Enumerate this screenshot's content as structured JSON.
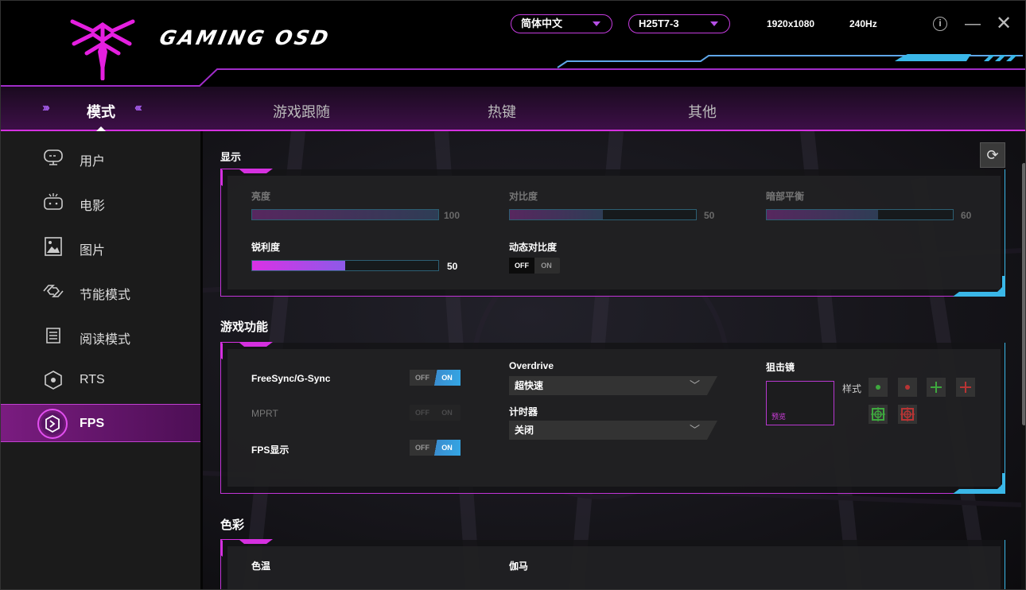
{
  "header": {
    "brand": "GAMING OSD",
    "language": "简体中文",
    "model": "H25T7-3",
    "resolution": "1920x1080",
    "refresh_rate": "240Hz",
    "info_icon": "i"
  },
  "tabs": [
    {
      "label": "模式"
    },
    {
      "label": "游戏跟随"
    },
    {
      "label": "热键"
    },
    {
      "label": "其他"
    }
  ],
  "sidebar": {
    "items": [
      {
        "label": "用户",
        "icon": "monitor-icon"
      },
      {
        "label": "电影",
        "icon": "cinema-icon"
      },
      {
        "label": "图片",
        "icon": "picture-icon"
      },
      {
        "label": "节能模式",
        "icon": "eco-icon"
      },
      {
        "label": "阅读模式",
        "icon": "reading-icon"
      },
      {
        "label": "RTS",
        "icon": "rts-icon"
      },
      {
        "label": "FPS",
        "icon": "fps-icon",
        "active": true
      }
    ]
  },
  "display": {
    "title": "显示",
    "brightness": {
      "label": "亮度",
      "value": "100",
      "fraction": 1.0
    },
    "contrast": {
      "label": "对比度",
      "value": "50",
      "fraction": 0.5
    },
    "dark_balance": {
      "label": "暗部平衡",
      "value": "60",
      "fraction": 0.6
    },
    "sharpness": {
      "label": "锐利度",
      "value": "50",
      "fraction": 0.5
    },
    "dynamic_contrast": {
      "label": "动态对比度",
      "off": "OFF",
      "on": "ON",
      "state": "off"
    }
  },
  "game": {
    "title": "游戏功能",
    "freesync": {
      "label": "FreeSync/G-Sync",
      "off": "OFF",
      "on": "ON",
      "state": "on"
    },
    "mprt": {
      "label": "MPRT",
      "off": "OFF",
      "on": "ON",
      "state": "disabled"
    },
    "fps_display": {
      "label": "FPS显示",
      "off": "OFF",
      "on": "ON",
      "state": "on"
    },
    "overdrive": {
      "label": "Overdrive",
      "value": "超快速"
    },
    "timer": {
      "label": "计时器",
      "value": "关闭"
    },
    "crosshair": {
      "label": "狙击镜",
      "preview": "预览",
      "style_label": "样式"
    }
  },
  "color": {
    "title": "色彩",
    "temperature": {
      "label": "色温"
    },
    "gamma": {
      "label": "伽马"
    }
  },
  "colors": {
    "accent": "#d530e0",
    "secondary": "#3ab7e8",
    "green": "#3ea83e",
    "red": "#b83434"
  }
}
